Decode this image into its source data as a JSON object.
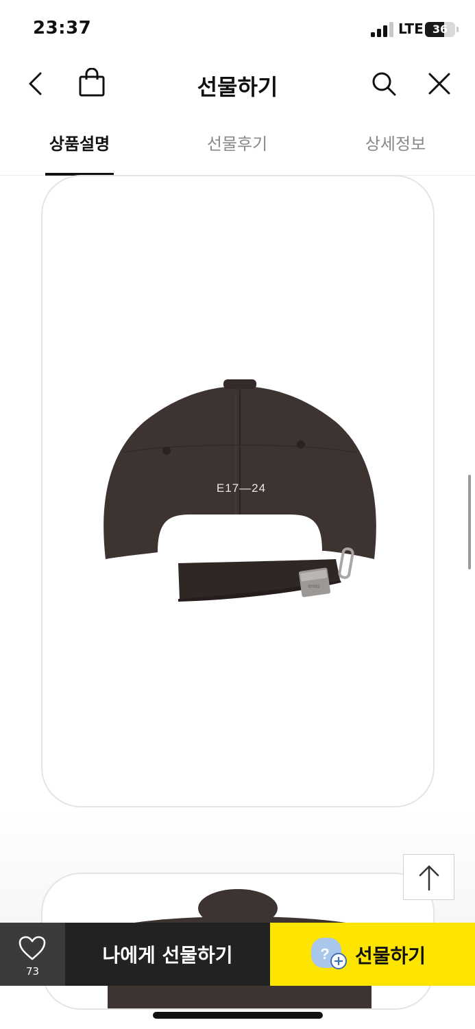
{
  "status_bar": {
    "time": "23:37",
    "network": "LTE",
    "battery": "36",
    "battery_level": 0.36
  },
  "header": {
    "title": "선물하기",
    "icons": [
      "back-icon",
      "shopping-bag-icon",
      "search-icon",
      "close-icon"
    ]
  },
  "tabs": [
    {
      "label": "상품설명",
      "active": true
    },
    {
      "label": "선물후기",
      "active": false
    },
    {
      "label": "상세정보",
      "active": false
    }
  ],
  "product": {
    "embroidery": "E17—24",
    "logo_text": "emis"
  },
  "bottom_bar": {
    "wish_count": "73",
    "self_gift_label": "나에게 선물하기",
    "gift_label": "선물하기",
    "gift_icon_text": "?"
  },
  "colors": {
    "accent": "#fee500",
    "dark_button": "#222222",
    "wish_button": "#3b3b3b",
    "cap": "#3d3330"
  }
}
